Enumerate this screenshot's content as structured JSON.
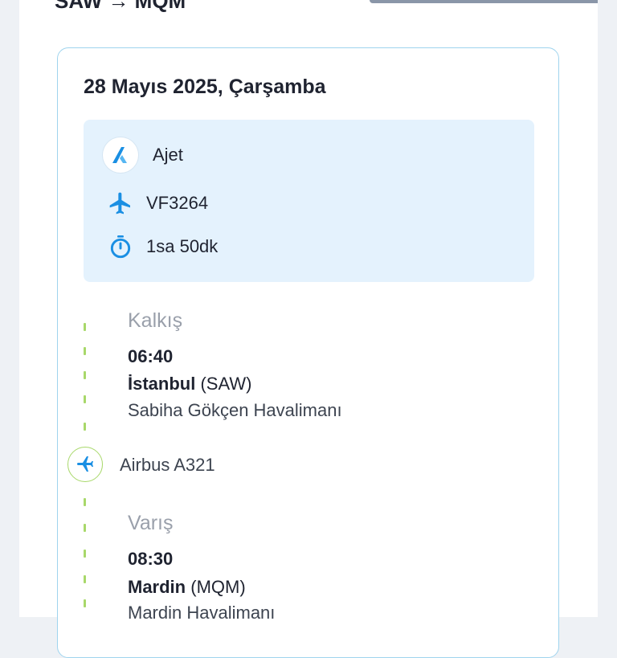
{
  "header": {
    "cut_title": "SAW → MQM"
  },
  "flight": {
    "date": "28 Mayıs 2025, Çarşamba",
    "airline": "Ajet",
    "airline_logo_letter": "A",
    "flight_number": "VF3264",
    "duration": "1sa 50dk",
    "aircraft": "Airbus A321"
  },
  "departure": {
    "label": "Kalkış",
    "time": "06:40",
    "city": "İstanbul",
    "code": "(SAW)",
    "airport": "Sabiha Gökçen Havalimanı"
  },
  "arrival": {
    "label": "Varış",
    "time": "08:30",
    "city": "Mardin",
    "code": "(MQM)",
    "airport": "Mardin Havalimanı"
  },
  "colors": {
    "accent_blue": "#1a8fe3",
    "timeline_green": "#a8d86a",
    "info_bg": "#e4f2fd"
  },
  "icons": [
    "airline-logo",
    "plane-icon",
    "stopwatch-icon",
    "plane-right-icon"
  ]
}
